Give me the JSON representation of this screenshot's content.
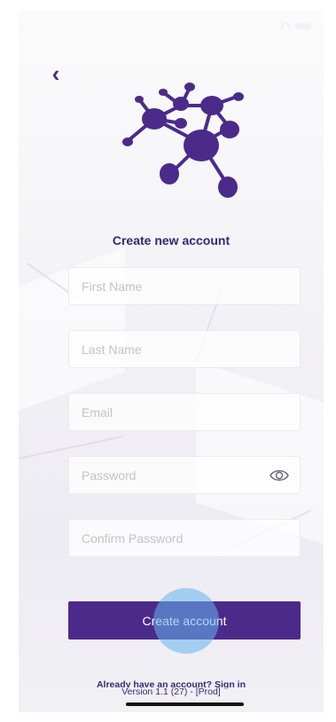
{
  "colors": {
    "brand": "#4c2a8a",
    "title": "#3b2571",
    "background": "#f1f0f5"
  },
  "nav": {
    "back_icon": "‹"
  },
  "logo": {
    "icon": "molecule-network-logo"
  },
  "title": "Create new account",
  "form": {
    "first_name": {
      "placeholder": "First Name",
      "value": ""
    },
    "last_name": {
      "placeholder": "Last Name",
      "value": ""
    },
    "email": {
      "placeholder": "Email",
      "value": ""
    },
    "password": {
      "placeholder": "Password",
      "value": "",
      "toggle_icon": "eye-icon"
    },
    "confirm_password": {
      "placeholder": "Confirm Password",
      "value": ""
    }
  },
  "actions": {
    "create_label": "Create account",
    "signin_text": "Already have an account? Sign in"
  },
  "footer": {
    "version": "Version 1.1 (27) - [Prod]"
  }
}
